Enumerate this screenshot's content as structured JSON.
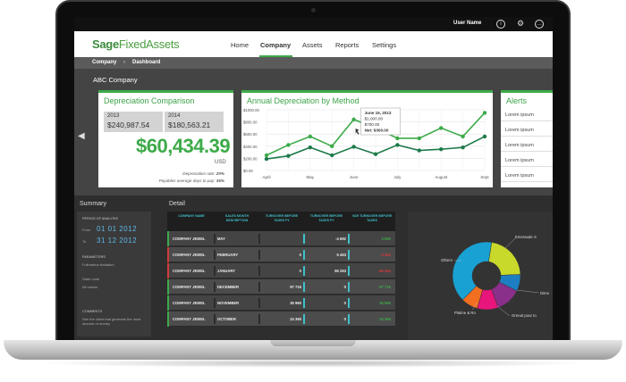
{
  "topbar": {
    "user_name": "User Name",
    "icons": [
      "info-icon",
      "gear-icon",
      "chat-icon"
    ]
  },
  "brand": {
    "part1": "Sage",
    "part2": "Fixed",
    "part3": "Assets"
  },
  "nav": {
    "items": [
      "Home",
      "Company",
      "Assets",
      "Reports",
      "Settings"
    ],
    "active": "Company"
  },
  "breadcrumb": {
    "items": [
      "Company",
      "Dashboard"
    ]
  },
  "company_name": "ABC Company",
  "depreciation_comparison": {
    "title": "Depreciation Comparison",
    "years": [
      {
        "year": "2013",
        "value": "$240,987.54"
      },
      {
        "year": "2014",
        "value": "$180,563.21"
      }
    ],
    "difference": "$60,434.39",
    "currency": "USD",
    "depreciation_rate_label": "Depreciation rate:",
    "depreciation_rate": "20%",
    "payables_label": "Payables average days to pay:",
    "payables_days": "35%"
  },
  "annual_chart": {
    "title": "Annual Depreciation by Method",
    "tooltip": {
      "date": "June 15, 2013",
      "line1": "$1,000.00",
      "line2": "$700.00",
      "net": "Net: $300.00"
    }
  },
  "chart_data": {
    "type": "line",
    "title": "Annual Depreciation by Method",
    "x": [
      "April",
      "",
      "May",
      "",
      "June",
      "",
      "July",
      "",
      "August",
      "",
      "Sept"
    ],
    "xlabel": "",
    "ylabel": "",
    "ylim": [
      0,
      1000
    ],
    "y_ticks": [
      "$0.00",
      "$200.00",
      "$400.00",
      "$600.00",
      "$800.00",
      "$1000.00"
    ],
    "series": [
      {
        "color": "#3daa49",
        "values": [
          250,
          420,
          560,
          400,
          840,
          700,
          530,
          530,
          700,
          560,
          950
        ]
      },
      {
        "color": "#1e7a4a",
        "values": [
          190,
          240,
          380,
          250,
          390,
          270,
          420,
          330,
          350,
          380,
          560
        ]
      }
    ],
    "grid": true
  },
  "alerts": {
    "title": "Alerts",
    "items": [
      "Lorem ipsum",
      "Lorem ipsum",
      "Lorem ipsum",
      "Lorem ipsum",
      "Lorem ipsum"
    ]
  },
  "summary": {
    "title": "Summary",
    "period_label": "Period of analysis",
    "from_label": "From",
    "from_date": "01 01 2012",
    "to_label": "To",
    "to_date": "31 12 2012",
    "parameters_label": "Parameters",
    "param1": "Fullmarina limitation",
    "param2": "State code",
    "param2_value": "All values",
    "comments_label": "Comments",
    "comment_text": "See the client that generate the most amount of money"
  },
  "detail": {
    "title": "Detail",
    "columns": [
      "Company name",
      "Sales month description",
      "Turnover before taxes FY",
      "Turnover before taxes FY",
      "VAR Turnover before taxes"
    ],
    "rows": [
      {
        "company": "COMPANY JEWEL",
        "month": "MAY",
        "t1": "",
        "t2": "-4 692",
        "var": "4 692",
        "flag": "#3daa49",
        "var_color": "#3daa49"
      },
      {
        "company": "COMPANY JEWEL",
        "month": "FEBRUARY",
        "t1": "0",
        "t2": "5 453",
        "var": "-5 453",
        "flag": "#d23b3b",
        "var_color": "#d23b3b"
      },
      {
        "company": "COMPANY JEWEL",
        "month": "JANUARY",
        "t1": "0",
        "t2": "65 263",
        "var": "-65 263",
        "flag": "#d23b3b",
        "var_color": "#d23b3b"
      },
      {
        "company": "COMPANY JEWEL",
        "month": "DECEMBER",
        "t1": "97 716",
        "t2": "0",
        "var": "97 716",
        "flag": "#3daa49",
        "var_color": "#3daa49"
      },
      {
        "company": "COMPANY JEWEL",
        "month": "NOVEMBER",
        "t1": "35 960",
        "t2": "0",
        "var": "35 960",
        "flag": "#3daa49",
        "var_color": "#3daa49"
      },
      {
        "company": "COMPANY JEWEL",
        "month": "OCTOBER",
        "t1": "24 360",
        "t2": "0",
        "var": "24 360",
        "flag": "#3daa49",
        "var_color": "#3daa49"
      }
    ]
  },
  "pie": {
    "labels": [
      "Emeraude S",
      "Others",
      "Dime",
      "Platine & Ro",
      "Grenat pour to"
    ],
    "slices": [
      {
        "value": 22,
        "color": "#c8d92b"
      },
      {
        "value": 8,
        "color": "#1d7fc1"
      },
      {
        "value": 12,
        "color": "#8a2f8a"
      },
      {
        "value": 10,
        "color": "#e8157c"
      },
      {
        "value": 8,
        "color": "#f26f21"
      },
      {
        "value": 40,
        "color": "#1aa1d4"
      }
    ]
  }
}
